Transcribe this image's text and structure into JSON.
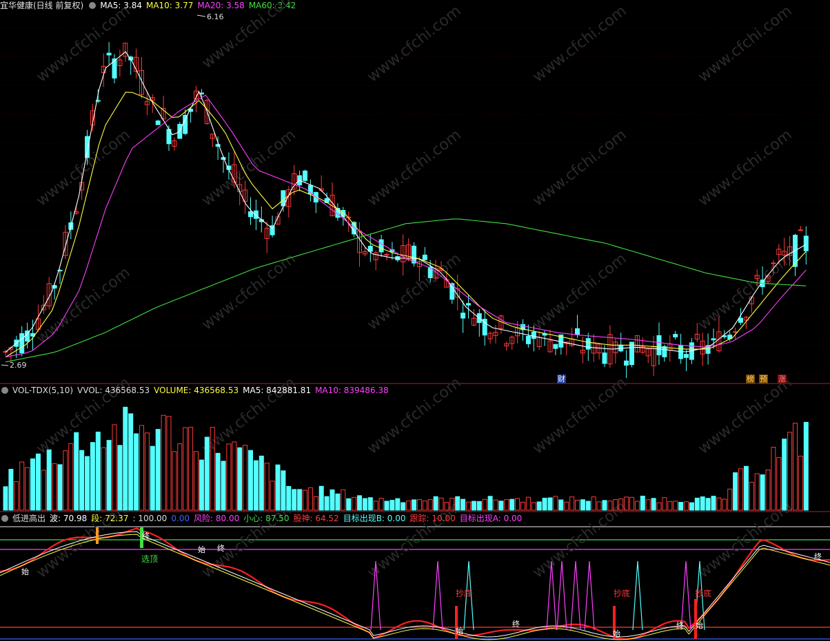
{
  "main_panel": {
    "title": "宜华健康(日线 前复权)",
    "ma5_label": "MA5: 3.84",
    "ma10_label": "MA10: 3.77",
    "ma20_label": "MA20: 3.58",
    "ma60_label": "MA60: 3.42",
    "high_mark": "6.16",
    "low_mark": "2.69",
    "event_tags": [
      "财",
      "榜",
      "预",
      "涨"
    ]
  },
  "vol_panel": {
    "title": "VOL-TDX(5,10)",
    "vvol_label": "VVOL: 436568.53",
    "volume_label": "VOLUME: 436568.53",
    "ma5_label": "MA5: 842881.81",
    "ma10_label": "MA10: 839486.38"
  },
  "ind_panel": {
    "title": "低进高出",
    "wave_label": "波: 70.98",
    "duan_label": "段: 72.37",
    "level_label": ": 100.00",
    "zero_label": "0.00",
    "risk_label": "风险: 80.00",
    "caution_label": "小心: 87.50",
    "demon_label": "股神: 64.52",
    "targetb_label": "目标出现B: 0.00",
    "track_label": "跟踪: 10.00",
    "targeta_label": "目标出现A: 0.00",
    "sig_top": "选顶",
    "sig_bottom": "抄底",
    "sig_start": "始",
    "sig_end": "终"
  },
  "watermark": "www.cfchi.com",
  "colors": {
    "up": "#ff3a3a",
    "down": "#54ffff",
    "ma5": "#ffffff",
    "ma10": "#ffff40",
    "ma20": "#ff40ff",
    "ma60": "#40e040",
    "bg": "#000000"
  },
  "chart_data": {
    "type": "candlestick",
    "series": [
      {
        "name": "MA5",
        "approx_path": [
          2.75,
          2.95,
          3.4,
          4.3,
          5.6,
          5.8,
          5.3,
          4.9,
          5.4,
          4.7,
          4.2,
          4.0,
          4.5,
          4.4,
          4.1,
          3.75,
          3.7,
          3.7,
          3.55,
          3.2,
          3.0,
          2.95,
          2.9,
          2.85,
          2.8,
          2.78,
          2.8,
          2.78,
          2.75,
          2.8,
          3.0,
          3.4,
          3.7,
          3.84
        ]
      },
      {
        "name": "MA10",
        "approx_path": [
          2.7,
          2.85,
          3.2,
          4.0,
          5.0,
          5.4,
          5.3,
          5.1,
          5.3,
          5.0,
          4.5,
          4.2,
          4.4,
          4.3,
          4.15,
          3.85,
          3.75,
          3.7,
          3.6,
          3.35,
          3.1,
          3.0,
          2.95,
          2.9,
          2.85,
          2.82,
          2.82,
          2.8,
          2.78,
          2.78,
          2.9,
          3.2,
          3.5,
          3.77
        ]
      },
      {
        "name": "MA20",
        "approx_path": [
          2.7,
          2.75,
          2.95,
          3.4,
          4.2,
          4.8,
          5.0,
          5.2,
          5.35,
          5.0,
          4.6,
          4.5,
          4.4,
          4.2,
          4.0,
          3.85,
          3.7,
          3.6,
          3.4,
          3.2,
          3.05,
          3.0,
          2.95,
          2.92,
          2.9,
          2.88,
          2.85,
          2.82,
          2.8,
          2.85,
          3.0,
          3.3,
          3.58
        ]
      },
      {
        "name": "MA60",
        "approx_path": [
          2.65,
          2.75,
          2.95,
          3.2,
          3.4,
          3.6,
          3.75,
          3.9,
          4.05,
          4.1,
          4.05,
          3.95,
          3.85,
          3.7,
          3.55,
          3.45,
          3.42
        ]
      }
    ],
    "price_high": 6.16,
    "price_low": 2.69,
    "latest_volume": 436568.53,
    "volume_ma5": 842881.81,
    "volume_ma10": 839486.38
  }
}
